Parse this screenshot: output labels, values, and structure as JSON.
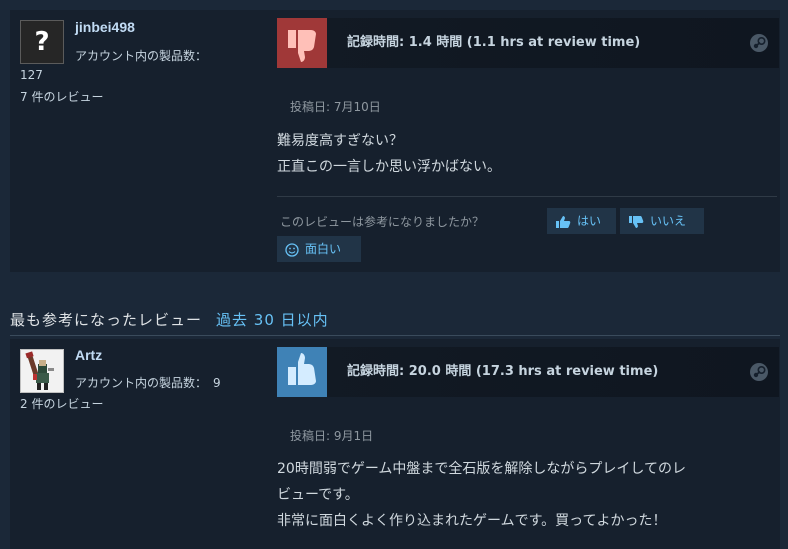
{
  "reviews": [
    {
      "username": "jinbei498",
      "avatar_icon": "question-mark",
      "products_label": "アカウント内の製品数：",
      "products_count": "127",
      "review_count": "7 件のレビュー",
      "vote": "not-recommended",
      "playtime": "記録時間: 1.4 時間 (1.1 hrs at review time)",
      "posted": "投稿日: 7月10日",
      "body_lines": [
        "難易度高すぎない？",
        "正直この一言しか思い浮かばない。"
      ]
    },
    {
      "username": "Artz",
      "avatar_icon": "pixel-character",
      "products_label": "アカウント内の製品数：",
      "products_count": "9",
      "review_count": "2 件のレビュー",
      "vote": "recommended",
      "playtime": "記録時間: 20.0 時間 (17.3 hrs at review time)",
      "posted": "投稿日: 9月1日",
      "body_lines": [
        "20時間弱でゲーム中盤まで全石版を解除しながらプレイしてのレ",
        "ビューです。",
        "非常に面白くよく作り込まれたゲームです。買ってよかった！"
      ]
    }
  ],
  "helpful": {
    "question": "このレビューは参考になりましたか？",
    "yes": "はい",
    "no": "いいえ",
    "funny": "面白い"
  },
  "section": {
    "title": "最も参考になったレビュー",
    "period": "過去 30 日以内"
  },
  "colors": {
    "background": "#1b2838",
    "card": "#16202d",
    "thumb_down": "#a03838",
    "thumb_up": "#3f82b6",
    "link": "#67c1f5"
  }
}
